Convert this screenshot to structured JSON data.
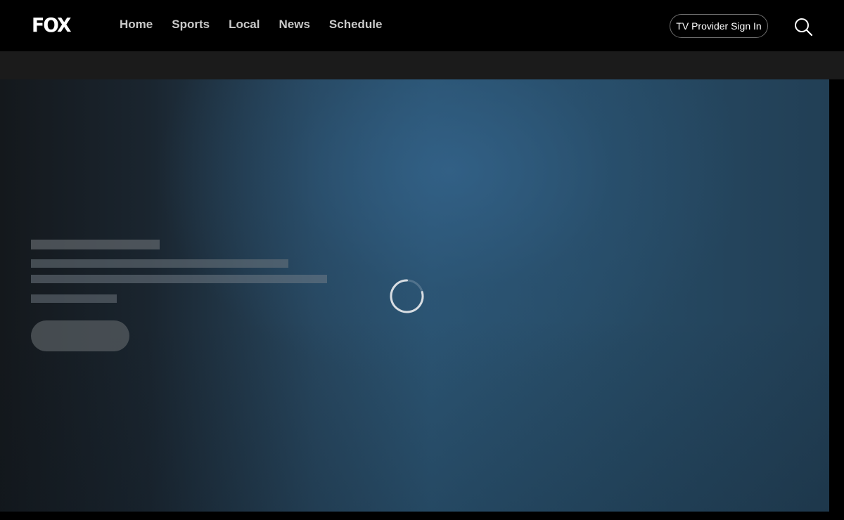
{
  "header": {
    "logo": "FOX",
    "nav": [
      {
        "label": "Home"
      },
      {
        "label": "Sports"
      },
      {
        "label": "Local"
      },
      {
        "label": "News"
      },
      {
        "label": "Schedule"
      }
    ],
    "provider_button": "TV Provider Sign In",
    "search_icon": "search-icon"
  },
  "hero": {
    "state": "loading",
    "spinner_icon": "loading-spinner-icon"
  },
  "colors": {
    "header_bg": "#000000",
    "subbar_bg": "#1b1b1b",
    "nav_text": "#c9c9c9",
    "hero_accent": "#2b5472"
  }
}
